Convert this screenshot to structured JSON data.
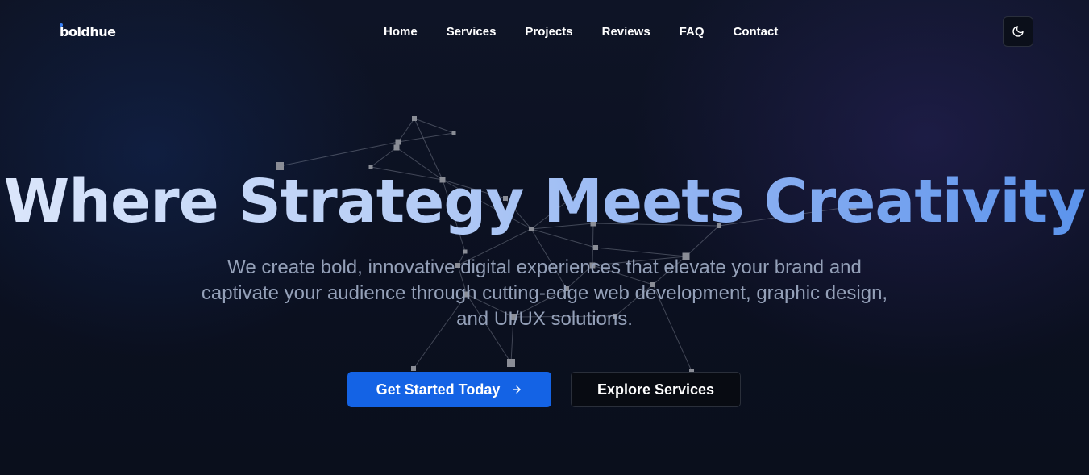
{
  "brand": {
    "logo_text": "boldhue",
    "accent_color": "#1463e5"
  },
  "nav": {
    "links": [
      {
        "label": "Home"
      },
      {
        "label": "Services"
      },
      {
        "label": "Projects"
      },
      {
        "label": "Reviews"
      },
      {
        "label": "FAQ"
      },
      {
        "label": "Contact"
      }
    ],
    "theme_toggle_icon": "moon-icon"
  },
  "hero": {
    "title": "Where Strategy Meets Creativity",
    "subtitle": "We create bold, innovative digital experiences that elevate your brand and captivate your audience through cutting-edge web development, graphic design, and UI/UX solutions.",
    "primary_cta": {
      "label": "Get Started Today",
      "icon": "arrow-right-icon"
    },
    "secondary_cta": {
      "label": "Explore Services"
    }
  },
  "background": {
    "decoration": "particle-network"
  }
}
